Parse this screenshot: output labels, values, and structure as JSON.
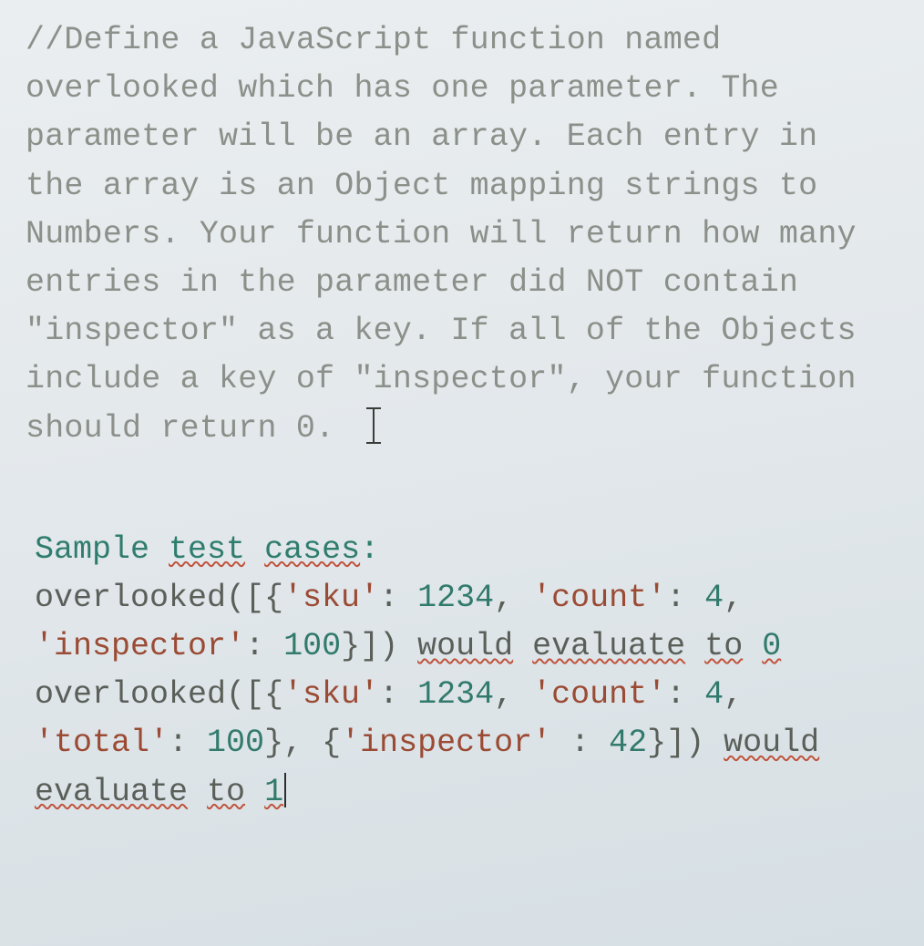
{
  "comment": {
    "l1": "//Define a JavaScript function named",
    "l2": "overlooked which has one parameter. The",
    "l3": "parameter will be an array. Each entry in",
    "l4": "the array is an Object mapping strings to",
    "l5": "Numbers. Your function will return how many",
    "l6": "entries in the parameter did NOT contain",
    "l7": "\"inspector\" as a key. If all of the Objects",
    "l8": "include a key of \"inspector\", your function",
    "l9": "should return 0."
  },
  "samples": {
    "heading_a": "Sample ",
    "heading_b": "test",
    "heading_c": " ",
    "heading_d": "cases",
    "heading_e": ":",
    "c1": {
      "pre": "overlooked([{",
      "k1": "'sku'",
      "s1": ": ",
      "v1": "1234",
      "s2": ", ",
      "k2": "'count'",
      "s3": ": ",
      "v2": "4",
      "s4": ",",
      "k3": "'inspector'",
      "s5": ": ",
      "v3": "100",
      "s6": "}]) ",
      "w1": "would",
      "sp1": " ",
      "w2": "evaluate",
      "sp2": " ",
      "w3": "to",
      "sp3": " ",
      "r": "0"
    },
    "c2": {
      "pre": "overlooked([{",
      "k1": "'sku'",
      "s1": ": ",
      "v1": "1234",
      "s2": ", ",
      "k2": "'count'",
      "s3": ": ",
      "v2": "4",
      "s4": ",",
      "k3": "'total'",
      "s5": ": ",
      "v3": "100",
      "s6": "}, {",
      "k4": "'inspector'",
      "s7": " : ",
      "v4": "42",
      "s8": "}]) ",
      "w1": "would",
      "w2": "evaluate",
      "sp1": " ",
      "w3": "to",
      "sp2": " ",
      "r": "1"
    }
  }
}
